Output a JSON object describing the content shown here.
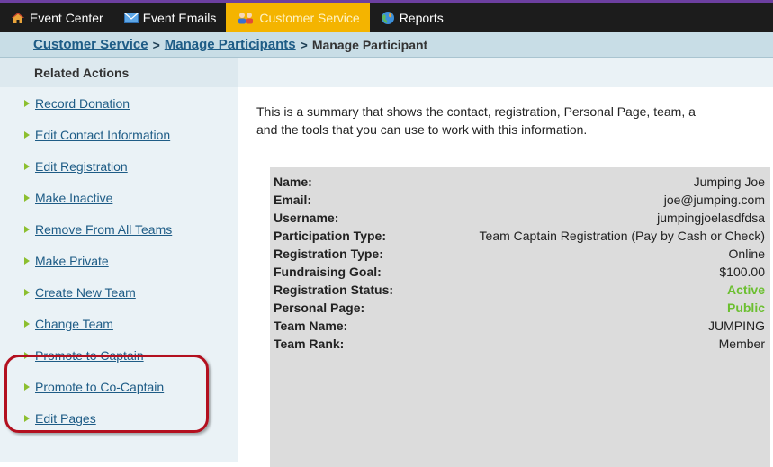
{
  "nav": {
    "tabs": [
      {
        "label": "Event Center",
        "icon": "home-icon"
      },
      {
        "label": "Event Emails",
        "icon": "envelope-icon"
      },
      {
        "label": "Customer Service",
        "icon": "people-icon",
        "active": true
      },
      {
        "label": "Reports",
        "icon": "globe-icon"
      }
    ]
  },
  "breadcrumb": {
    "items": [
      "Customer Service",
      "Manage Participants"
    ],
    "separator": ">",
    "current": "Manage Participant"
  },
  "sidebar": {
    "title": "Related Actions",
    "actions": [
      "Record Donation",
      "Edit Contact Information",
      "Edit Registration",
      "Make Inactive",
      "Remove From All Teams",
      "Make Private",
      "Create New Team",
      "Change Team",
      "Promote to Captain",
      "Promote to Co-Captain",
      "Edit Pages"
    ]
  },
  "main": {
    "intro_line1": "This is a summary that shows the contact, registration, Personal Page, team, a",
    "intro_line2": "and the tools that you can use to work with this information.",
    "summary": [
      {
        "label": "Name:",
        "value": "Jumping Joe"
      },
      {
        "label": "Email:",
        "value": "joe@jumping.com"
      },
      {
        "label": "Username:",
        "value": "jumpingjoelasdfdsa"
      },
      {
        "label": "Participation Type:",
        "value": "Team Captain Registration (Pay by Cash or Check)"
      },
      {
        "label": "Registration Type:",
        "value": "Online"
      },
      {
        "label": "Fundraising Goal:",
        "value": "$100.00"
      },
      {
        "label": "Registration Status:",
        "value": "Active",
        "highlight": true
      },
      {
        "label": "Personal Page:",
        "value": "Public",
        "highlight": true
      },
      {
        "label": "Team Name:",
        "value": "JUMPING"
      },
      {
        "label": "Team Rank:",
        "value": "Member"
      }
    ]
  },
  "colors": {
    "topbar": "#1c1c1c",
    "active_tab": "#f4b400",
    "breadcrumb_bg": "#c8dde6",
    "link": "#1e5c86",
    "status_green": "#6bbf30",
    "highlight_ring": "#b3101f"
  }
}
